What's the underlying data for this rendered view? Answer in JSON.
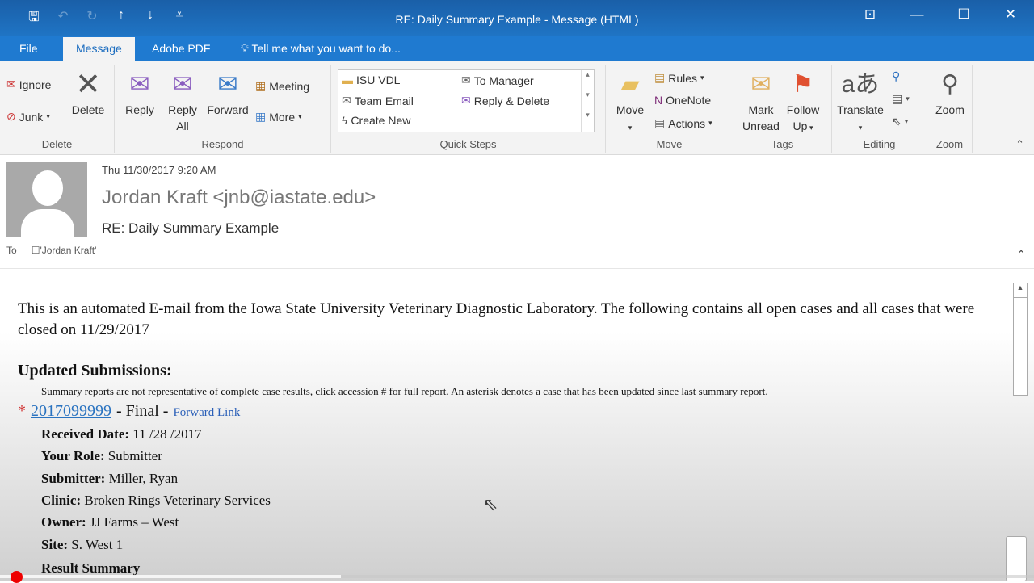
{
  "window": {
    "title": "RE: Daily Summary Example - Message (HTML)",
    "qat": {
      "save_icon": "🖫",
      "undo_icon": "↶",
      "redo_icon": "↻",
      "up_icon": "↑",
      "down_icon": "↓",
      "customize_icon": "⩡"
    },
    "controls": {
      "ribbon_display": "⊡",
      "minimize": "—",
      "maximize": "☐",
      "close": "✕"
    }
  },
  "tabs": [
    {
      "label": "File"
    },
    {
      "label": "Message"
    },
    {
      "label": "Adobe PDF"
    },
    {
      "label": "Tell me what you want to do..."
    }
  ],
  "ribbon": {
    "delete_group": {
      "label": "Delete",
      "ignore": "Ignore",
      "junk": "Junk",
      "delete": "Delete"
    },
    "respond_group": {
      "label": "Respond",
      "reply": "Reply",
      "reply_all_1": "Reply",
      "reply_all_2": "All",
      "forward": "Forward",
      "meeting": "Meeting",
      "more": "More"
    },
    "quick_steps": {
      "label": "Quick Steps",
      "items": [
        "ISU VDL",
        "Team Email",
        "Create New",
        "To Manager",
        "Reply & Delete"
      ]
    },
    "move_group": {
      "label": "Move",
      "move": "Move",
      "rules": "Rules",
      "onenote": "OneNote",
      "actions": "Actions"
    },
    "tags_group": {
      "label": "Tags",
      "mark1": "Mark",
      "mark2": "Unread",
      "follow1": "Follow",
      "follow2": "Up"
    },
    "editing_group": {
      "label": "Editing",
      "translate": "Translate"
    },
    "zoom_group": {
      "label": "Zoom",
      "zoom": "Zoom"
    }
  },
  "message": {
    "date": "Thu 11/30/2017 9:20 AM",
    "from": "Jordan Kraft <jnb@iastate.edu>",
    "subject": "RE: Daily Summary Example",
    "to_label": "To",
    "to": "'Jordan Kraft'"
  },
  "body": {
    "intro": "This is an automated E-mail from the Iowa State University Veterinary Diagnostic Laboratory. The following contains all open cases and all cases that were closed on 11/29/2017",
    "heading": "Updated Submissions:",
    "note": "Summary reports are not representative of complete case results, click accession # for full report. An asterisk denotes a case that has been updated since last summary report.",
    "case": {
      "star": "*",
      "accession": "2017099999",
      "status": "- Final -",
      "forward_link": "Forward Link",
      "fields": [
        {
          "label": "Received Date:",
          "value": " 11 /28 /2017"
        },
        {
          "label": "Your Role:",
          "value": " Submitter"
        },
        {
          "label": "Submitter:",
          "value": " Miller, Ryan"
        },
        {
          "label": "Clinic:",
          "value": " Broken Rings Veterinary Services"
        },
        {
          "label": "Owner:",
          "value": " JJ Farms – West"
        },
        {
          "label": "Site:",
          "value": " S. West 1"
        },
        {
          "label": "Result Summary",
          "value": ""
        }
      ]
    }
  }
}
